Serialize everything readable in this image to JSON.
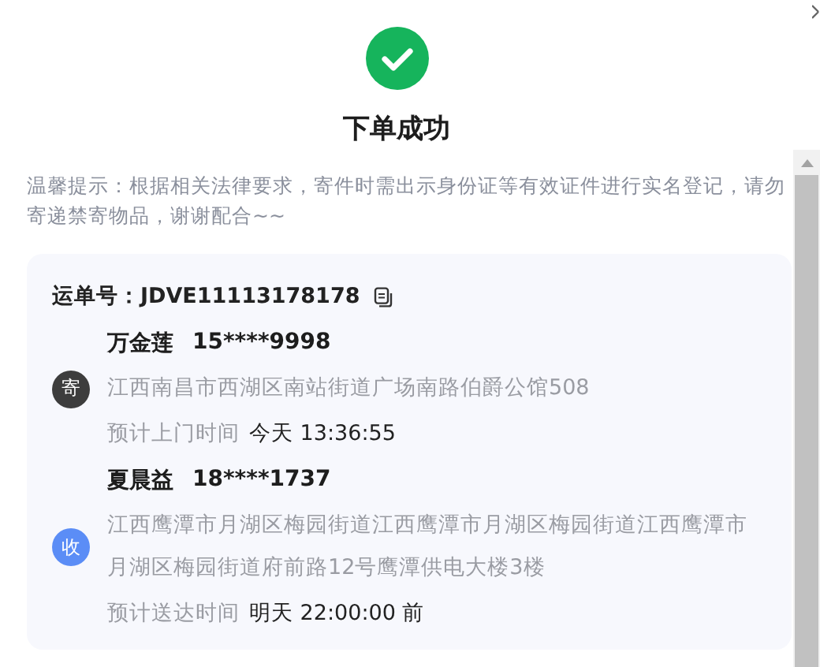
{
  "title": "下单成功",
  "notice": "温馨提示：根据相关法律要求，寄件时需出示身份证等有效证件进行实名登记，请勿寄递禁寄物品，谢谢配合~~",
  "waybill": {
    "label": "运单号：",
    "number": "JDVE11113178178"
  },
  "parties": [
    {
      "badge": "寄",
      "color": "#3d3d3d",
      "name": "万金莲",
      "phone": "15****9998",
      "address": "江西南昌市西湖区南站街道广场南路伯爵公馆508",
      "time_label": "预计上门时间",
      "time_value": "今天 13:36:55"
    },
    {
      "badge": "收",
      "color": "#5b8df6",
      "name": "夏晨益",
      "phone": "18****1737",
      "address": "江西鹰潭市月湖区梅园街道江西鹰潭市月湖区梅园街道江西鹰潭市月湖区梅园街道府前路12号鹰潭供电大楼3楼",
      "time_label": "预计送达时间",
      "time_value": "明天 22:00:00 前"
    }
  ]
}
